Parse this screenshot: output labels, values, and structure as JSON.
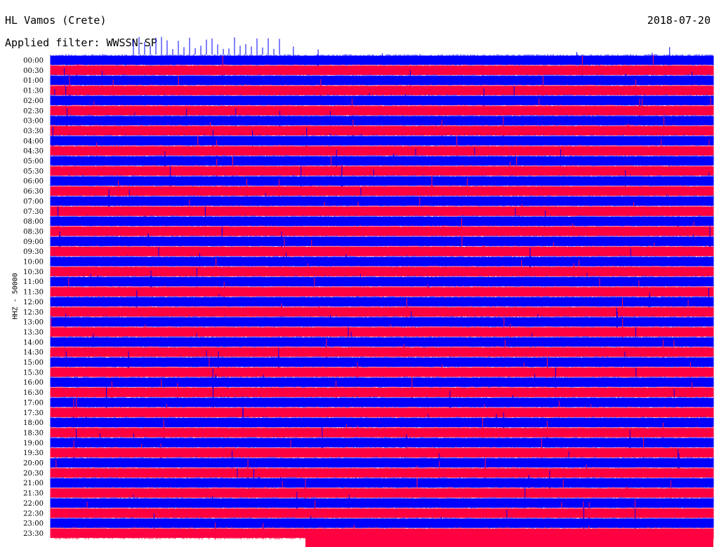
{
  "header": {
    "station": "HL Vamos (Crete)",
    "date": "2018-07-20",
    "filter": "Applied filter: WWSSN-SP"
  },
  "chart_data": {
    "type": "line",
    "title": "HL Vamos (Crete)",
    "ylabel": "HHZ - 50000",
    "row_labels": [
      "00:00",
      "00:30",
      "01:00",
      "01:30",
      "02:00",
      "02:30",
      "03:00",
      "03:30",
      "04:00",
      "04:30",
      "05:00",
      "05:30",
      "06:00",
      "06:30",
      "07:00",
      "07:30",
      "08:00",
      "08:30",
      "09:00",
      "09:30",
      "10:00",
      "10:30",
      "11:00",
      "11:30",
      "12:00",
      "12:30",
      "13:00",
      "13:30",
      "14:00",
      "14:30",
      "15:00",
      "15:30",
      "16:00",
      "16:30",
      "17:00",
      "17:30",
      "18:00",
      "18:30",
      "19:00",
      "19:30",
      "20:00",
      "20:30",
      "21:00",
      "21:30",
      "22:00",
      "22:30",
      "23:00",
      "23:30"
    ],
    "trace_colors": [
      "#0000ff",
      "#ff0040"
    ]
  }
}
